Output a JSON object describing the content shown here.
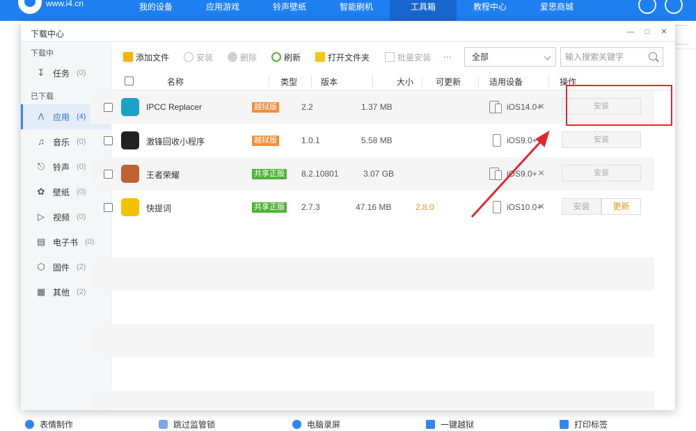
{
  "topbar": {
    "site": "www.i4.cn",
    "nav": [
      "我的设备",
      "应用游戏",
      "铃声壁纸",
      "智能刷机",
      "工具箱",
      "教程中心",
      "爱思商城"
    ],
    "active_nav": "工具箱",
    "colors": {
      "brand": "#1e7ff0",
      "active": "#1667cd"
    },
    "icons": [
      "download-circle-icon",
      "user-avatar-icon"
    ]
  },
  "dialog": {
    "title": "下载中心",
    "window_buttons": [
      "minimize-icon",
      "maximize-icon",
      "close-icon"
    ]
  },
  "sidebar": {
    "sections": {
      "downloading": "下载中",
      "downloaded": "已下载"
    },
    "items": [
      {
        "label": "任务",
        "count": "(0)",
        "icon": "download-arrow-icon"
      },
      {
        "label": "应用",
        "count": "(4)",
        "icon": "app-store-icon",
        "active": true
      },
      {
        "label": "音乐",
        "count": "(0)",
        "icon": "music-note-icon"
      },
      {
        "label": "铃声",
        "count": "(0)",
        "icon": "bell-icon"
      },
      {
        "label": "壁纸",
        "count": "(0)",
        "icon": "flower-icon"
      },
      {
        "label": "视频",
        "count": "(0)",
        "icon": "video-icon"
      },
      {
        "label": "电子书",
        "count": "(0)",
        "icon": "ebook-icon"
      },
      {
        "label": "固件",
        "count": "(2)",
        "icon": "cube-icon"
      },
      {
        "label": "其他",
        "count": "(2)",
        "icon": "grid-icon"
      }
    ]
  },
  "toolbar": {
    "add_file": "添加文件",
    "install": "安装",
    "delete": "删除",
    "refresh": "刷新",
    "open_folder": "打开文件夹",
    "batch_install": "批量安装",
    "filter_value": "全部",
    "search_placeholder": "输入搜索关键字"
  },
  "table": {
    "headers": [
      "名称",
      "类型",
      "版本",
      "大小",
      "可更新",
      "适用设备",
      "操作"
    ],
    "rows": [
      {
        "name": "IPCC Replacer",
        "type": "越狱版",
        "type_kind": "jailbreak",
        "version": "2.2",
        "size": "1.37 MB",
        "update": "",
        "device": "iOS14.0+",
        "device_kind": "ipad-iphone",
        "install": "安装",
        "icon": "ipcc-replacer-app-icon",
        "icon_color": "#1aa3c9"
      },
      {
        "name": "激锋回收小程序",
        "type": "越狱版",
        "type_kind": "jailbreak",
        "version": "1.0.1",
        "size": "5.58 MB",
        "update": "",
        "device": "iOS9.0+",
        "device_kind": "iphone",
        "install": "安装",
        "icon": "recycle-miniapp-icon",
        "icon_color": "#222222"
      },
      {
        "name": "王者荣耀",
        "type": "共享正版",
        "type_kind": "shared",
        "version": "8.2.10801",
        "size": "3.07 GB",
        "update": "",
        "device": "iOS9.0+",
        "device_kind": "ipad-iphone",
        "install": "安装",
        "icon": "honor-of-kings-icon",
        "icon_color": "#c0622f"
      },
      {
        "name": "快提词",
        "type": "共享正版",
        "type_kind": "shared",
        "version": "2.7.3",
        "size": "47.16 MB",
        "update": "2.8.0",
        "device": "iOS10.0+",
        "device_kind": "iphone",
        "install": "安装",
        "update_btn": "更新",
        "icon": "teleprompter-app-icon",
        "icon_color": "#f2c200"
      }
    ]
  },
  "bottombar": [
    "表情制作",
    "跳过监管锁",
    "电脑录屏",
    "一键越狱",
    "打印标签"
  ],
  "annotation": {
    "color": "#e8242b"
  }
}
